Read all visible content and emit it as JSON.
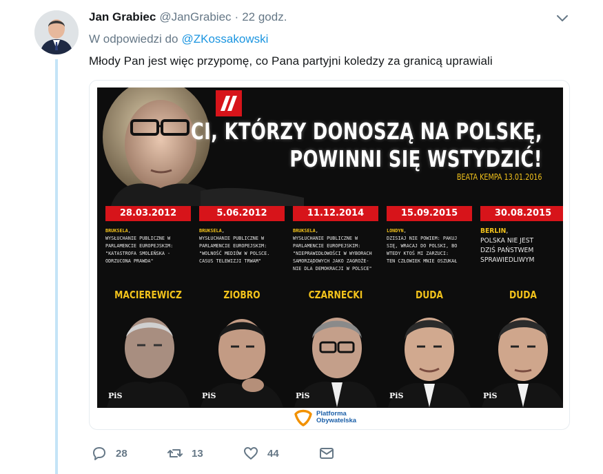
{
  "tweet": {
    "author_name": "Jan Grabiec",
    "author_handle": "@JanGrabiec",
    "separator": "·",
    "timestamp": "22 godz.",
    "reply_prefix": "W odpowiedzi do",
    "reply_mention": "@ZKossakowski",
    "text": "Młody Pan jest więc przypomę, co Pana partyjni koledzy za granicą uprawiali"
  },
  "poster": {
    "headline_line1": "CI, KTÓRZY DONOSZĄ NA POLSKĘ,",
    "headline_line2": "POWINNI SIĘ WSTYDZIĆ!",
    "quote_author": "BEATA KEMPA 13.01.2016",
    "party_mark": "PiS",
    "footer_logo_line1": "Platforma",
    "footer_logo_line2": "Obywatelska",
    "columns": [
      {
        "date": "28.03.2012",
        "place": "BRUKSELA",
        "desc": ",\nWYSŁUCHANIE PUBLICZNE W\nPARLAMENCIE EUROPEJSKIM:\n\"KATASTROFA SMOLEŃSKA -\nODRZUCONA PRAWDA\"",
        "name": "MACIEREWICZ"
      },
      {
        "date": "5.06.2012",
        "place": "BRUKSELA",
        "desc": ",\nWYSŁUCHANIE PUBLICZNE W\nPARLAMENCIE EUROPEJSKIM:\n\"WOLNOŚĆ MEDIÓW W POLSCE.\nCASUS TELEWIZJI TRWAM\"",
        "name": "ZIOBRO"
      },
      {
        "date": "11.12.2014",
        "place": "BRUKSELA",
        "desc": ",\nWYSŁUCHANIE PUBLICZNE W\nPARLAMENCIE EUROPEJSKIM:\n\"NIEPRAWIDŁOWOŚCI W WYBORACH\nSAMORZĄDOWYCH JAKO ZAGROŻE-\nNIE DLA DEMOKRACJI W POLSCE\"",
        "name": "CZARNECKI"
      },
      {
        "date": "15.09.2015",
        "place": "LONDYN",
        "desc": ",\nDZISIAJ NIE POWIEM: PAKUJ\nSIĘ, WRACAJ DO POLSKI, BO\nWTEDY KTOŚ MI ZARZUCI:\nTEN CZŁOWIEK MNIE OSZUKAŁ",
        "name": "DUDA"
      },
      {
        "date": "30.08.2015",
        "place": "BERLIN",
        "desc": ",\nPOLSKA NIE JEST\nDZIŚ PAŃSTWEM\nSPRAWIEDLIWYM",
        "name": "DUDA"
      }
    ]
  },
  "actions": {
    "reply_count": "28",
    "retweet_count": "13",
    "like_count": "44"
  },
  "colors": {
    "accent": "#1b95e0",
    "muted": "#657786",
    "thread_line": "#c4e4f7",
    "poster_red": "#d7141a",
    "poster_yellow": "#f2c21b"
  }
}
